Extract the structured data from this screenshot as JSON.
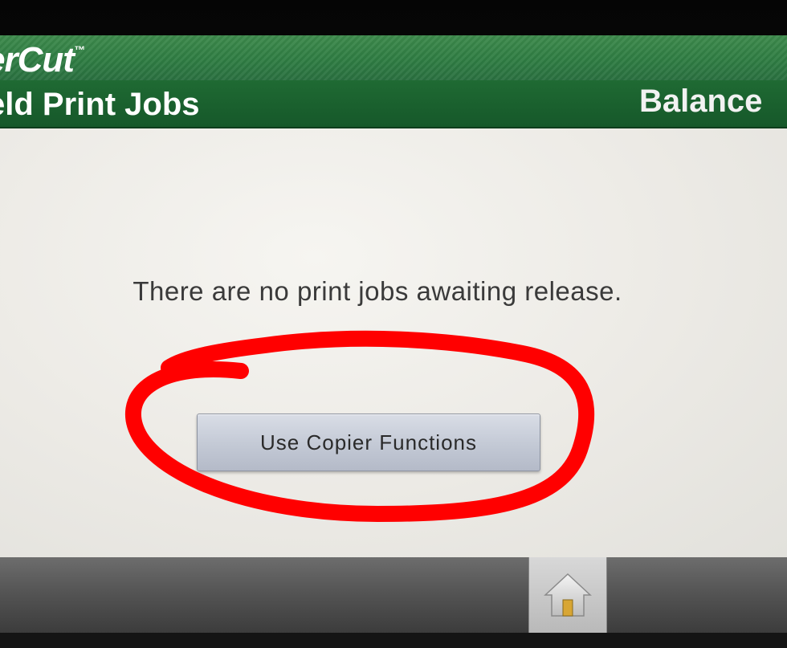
{
  "header": {
    "brand_text": "erCut",
    "brand_mark": "™",
    "page_title": "eld Print Jobs",
    "balance_label": "Balance"
  },
  "main": {
    "message": "There are no print jobs awaiting release.",
    "copier_button_label": "Use Copier Functions"
  },
  "footer": {
    "home_icon": "home-icon"
  },
  "annotation": {
    "color": "#ff0000",
    "shape": "hand-drawn ellipse circling the copier button"
  },
  "colors": {
    "brand_green": "#2f7d43",
    "title_green": "#1a5e2e",
    "screen_bg": "#eceae5"
  }
}
